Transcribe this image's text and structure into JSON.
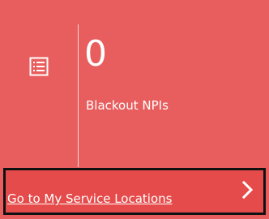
{
  "tile": {
    "count": "0",
    "label": "Blackout NPIs",
    "icon": "list-icon",
    "background_color": "#e85d5d"
  },
  "footer": {
    "link_label": "Go to My Service Locations",
    "chevron_icon": "chevron-right-icon"
  }
}
